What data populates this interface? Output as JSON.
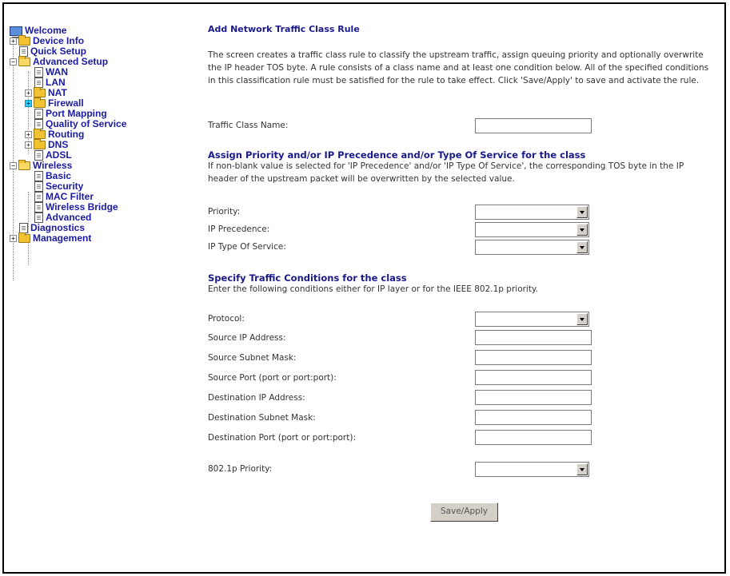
{
  "sidebar": {
    "items": [
      {
        "label": "Welcome"
      },
      {
        "label": "Device Info"
      },
      {
        "label": "Quick Setup"
      },
      {
        "label": "Advanced Setup"
      },
      {
        "label": "WAN"
      },
      {
        "label": "LAN"
      },
      {
        "label": "NAT"
      },
      {
        "label": "Firewall"
      },
      {
        "label": "Port Mapping"
      },
      {
        "label": "Quality of Service"
      },
      {
        "label": "Routing"
      },
      {
        "label": "DNS"
      },
      {
        "label": "ADSL"
      },
      {
        "label": "Wireless"
      },
      {
        "label": "Basic"
      },
      {
        "label": "Security"
      },
      {
        "label": "MAC Filter"
      },
      {
        "label": "Wireless Bridge"
      },
      {
        "label": "Advanced"
      },
      {
        "label": "Diagnostics"
      },
      {
        "label": "Management"
      }
    ]
  },
  "main": {
    "title": "Add Network Traffic Class Rule",
    "intro": "The screen creates a traffic class rule to classify the upstream traffic, assign queuing priority and optionally overwrite the IP header TOS byte. A rule consists of a class name and at least one condition below. All of the specified conditions in this classification rule must be satisfied for the rule to take effect. Click 'Save/Apply' to save and activate the rule.",
    "class_name_label": "Traffic Class Name:",
    "class_name_value": "",
    "priority_heading": "Assign Priority and/or IP Precedence and/or Type Of Service for the class",
    "priority_desc": "If non-blank value is selected for 'IP Precedence' and/or 'IP Type Of Service', the corresponding TOS byte in the IP header of the upstream packet will be overwritten by the selected value.",
    "priority_label": "Priority:",
    "priority_value": "",
    "ip_precedence_label": "IP Precedence:",
    "ip_precedence_value": "",
    "tos_label": "IP Type Of Service:",
    "tos_value": "",
    "conditions_heading": "Specify Traffic Conditions for the class",
    "conditions_desc": "Enter the following conditions either for IP layer or for the IEEE 802.1p priority.",
    "protocol_label": "Protocol:",
    "protocol_value": "",
    "src_ip_label": "Source IP Address:",
    "src_ip_value": "",
    "src_mask_label": "Source Subnet Mask:",
    "src_mask_value": "",
    "src_port_label": "Source Port (port or port:port):",
    "src_port_value": "",
    "dst_ip_label": "Destination IP Address:",
    "dst_ip_value": "",
    "dst_mask_label": "Destination Subnet Mask:",
    "dst_mask_value": "",
    "dst_port_label": "Destination Port (port or port:port):",
    "dst_port_value": "",
    "dot1p_label": "802.1p Priority:",
    "dot1p_value": "",
    "save_label": "Save/Apply"
  }
}
